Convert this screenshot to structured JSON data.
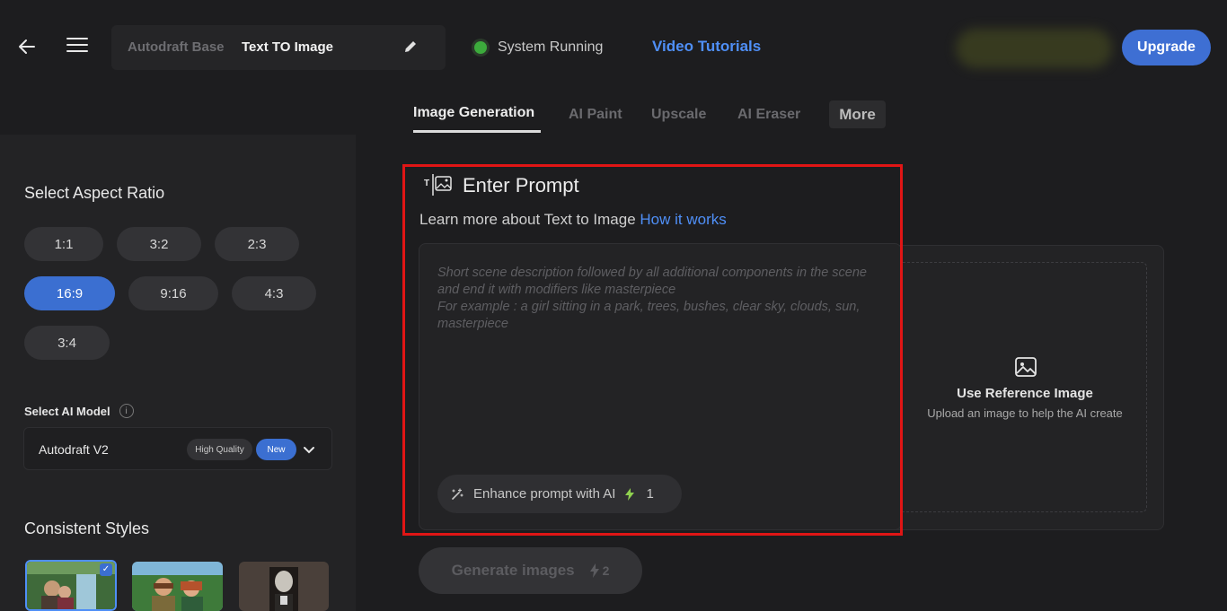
{
  "header": {
    "back_icon": "arrow-left-icon",
    "menu_icon": "hamburger-icon",
    "breadcrumb_base": "Autodraft Base",
    "breadcrumb_title": "Text TO Image",
    "edit_icon": "pencil-icon",
    "status_text": "System Running",
    "status_color": "#3cab3c",
    "tutorials_label": "Video Tutorials",
    "upgrade_label": "Upgrade",
    "accent_color": "#3e6fd3"
  },
  "sidebar": {
    "aspect_title": "Select Aspect Ratio",
    "ratios": [
      "1:1",
      "3:2",
      "2:3",
      "16:9",
      "9:16",
      "4:3",
      "3:4"
    ],
    "selected_ratio": "16:9",
    "model_label": "Select AI Model",
    "info_symbol": "i",
    "model_name": "Autodraft V2",
    "badge_quality": "High Quality",
    "badge_new": "New",
    "styles_title": "Consistent Styles",
    "style_thumbs": [
      "style-waterfall-couple",
      "style-forest-couple",
      "style-gothic-girl"
    ]
  },
  "tabs": {
    "items": [
      "Image Generation",
      "AI Paint",
      "Upscale",
      "AI Eraser"
    ],
    "active": "Image Generation",
    "more_label": "More"
  },
  "prompt": {
    "title": "Enter Prompt",
    "learn_text": "Learn more about Text to Image",
    "learn_link": "How it works",
    "placeholder_line1": "Short scene description followed by all additional components in the scene and end it with modifiers like masterpiece",
    "placeholder_line2": "For example : a girl sitting in a park, trees, bushes, clear sky, clouds, sun, masterpiece",
    "enhance_label": "Enhance prompt with AI",
    "enhance_cost": "1"
  },
  "reference": {
    "icon": "image-icon",
    "title": "Use Reference Image",
    "subtitle": "Upload an image to help the AI create"
  },
  "generate": {
    "label": "Generate images",
    "cost": "2"
  }
}
